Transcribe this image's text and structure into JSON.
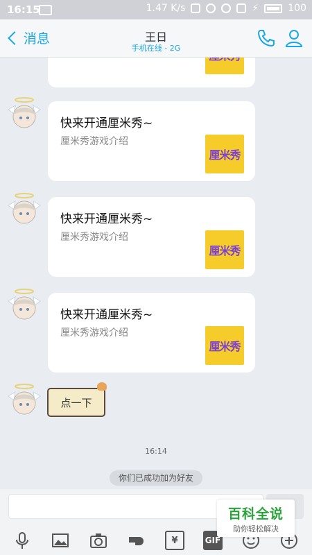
{
  "status_bar": {
    "time": "16:15",
    "speed": "1.47 K/s",
    "battery": "100"
  },
  "header": {
    "back_label": "消息",
    "title": "王日",
    "subtitle": "手机在线 - 2G"
  },
  "messages": [
    {
      "title": "快来开通厘米秀~",
      "subtitle": "厘米秀游戏介绍",
      "thumb_text": "厘米秀"
    },
    {
      "title": "快来开通厘米秀~",
      "subtitle": "厘米秀游戏介绍",
      "thumb_text": "厘米秀"
    },
    {
      "title": "快来开通厘米秀~",
      "subtitle": "厘米秀游戏介绍",
      "thumb_text": "厘米秀"
    }
  ],
  "partial_thumb_text": "厘米秀",
  "sticker_text": "点一下",
  "timestamp": "16:14",
  "system_notice": "你们已成功加为好友",
  "toolbar": {
    "gif_label": "GIF",
    "money_label": "¥"
  },
  "watermark": {
    "main": "百科全说",
    "sub": "助你轻松解决"
  },
  "colors": {
    "accent": "#1aa7e6",
    "background": "#e9ecf1",
    "thumb_bg": "#f5cc2a",
    "thumb_text": "#7b3fd1",
    "watermark_green": "#2aa33b"
  }
}
